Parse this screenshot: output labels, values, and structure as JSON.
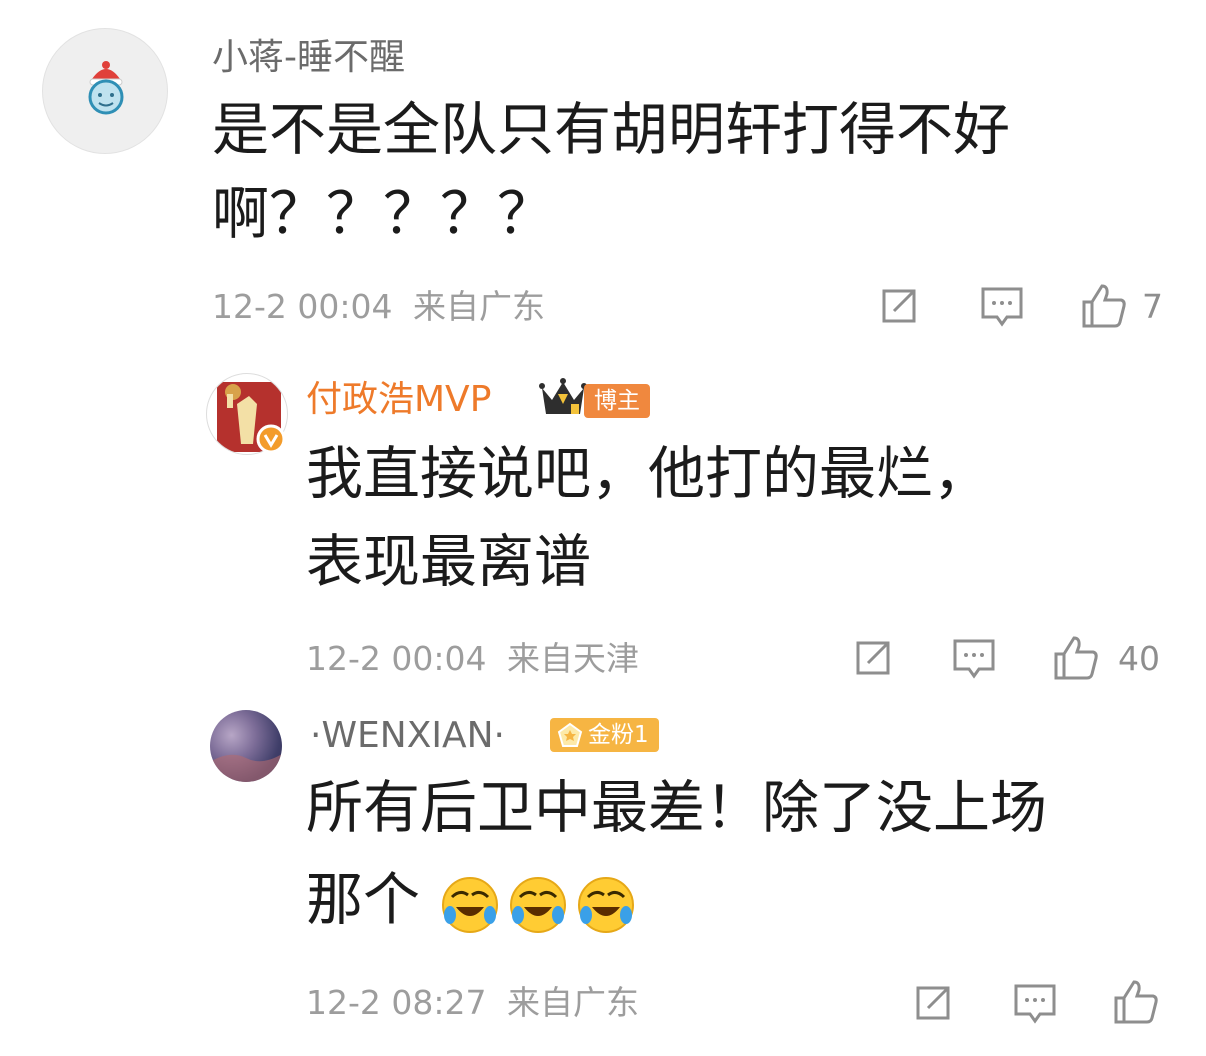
{
  "comments": [
    {
      "username": "小蒋-睡不醒",
      "text_line1": "是不是全队只有胡明轩打得不好",
      "text_line2": "啊？？？？？",
      "timestamp": "12-2 00:04",
      "location": "来自广东",
      "likes": "7",
      "avatar_icon": "cartoon-avatar-icon"
    },
    {
      "username": "付政浩MVP",
      "badge": "博主",
      "text_line1": "我直接说吧，他打的最烂，",
      "text_line2": "表现最离谱",
      "timestamp": "12-2 00:04",
      "location": "来自天津",
      "likes": "40",
      "avatar_icon": "verified-avatar-icon"
    },
    {
      "username": "·WENXIAN·",
      "badge": "金粉1",
      "text_line1": "所有后卫中最差！除了没上场",
      "text_line2": "那个",
      "emojis": [
        "laugh-cry-emoji",
        "laugh-cry-emoji",
        "laugh-cry-emoji"
      ],
      "timestamp": "12-2 08:27",
      "location": "来自广东",
      "avatar_icon": "photo-avatar-icon"
    }
  ],
  "colors": {
    "username_gray": "#6b6b6b",
    "username_orange": "#ee7a2a",
    "meta_gray": "#9d9d9d",
    "badge_blogger": "#f0883e",
    "badge_fan": "#f6b543"
  }
}
